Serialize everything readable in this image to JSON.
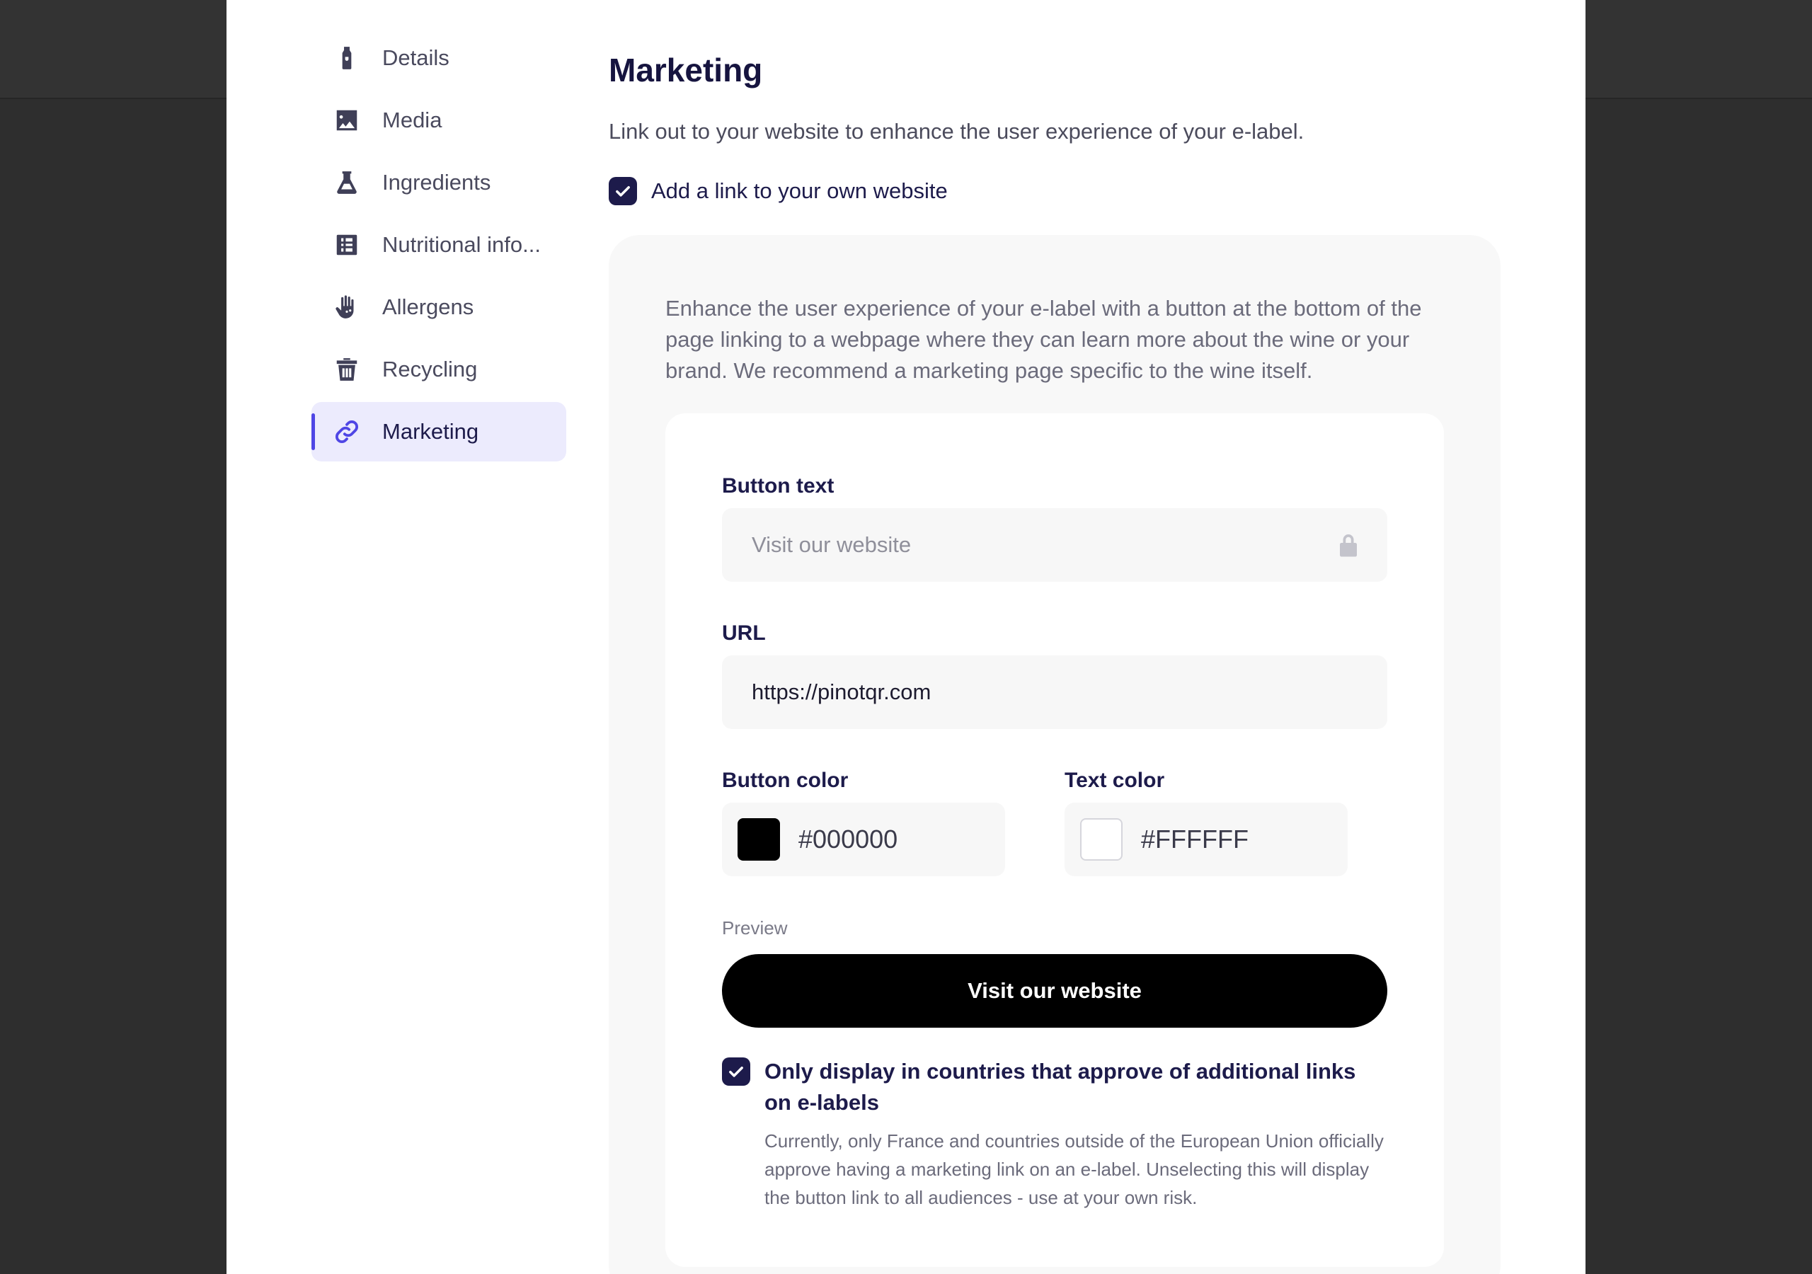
{
  "sidebar": {
    "items": [
      {
        "label": "Details",
        "icon": "bottle-icon"
      },
      {
        "label": "Media",
        "icon": "image-icon"
      },
      {
        "label": "Ingredients",
        "icon": "flask-icon"
      },
      {
        "label": "Nutritional info...",
        "icon": "list-icon"
      },
      {
        "label": "Allergens",
        "icon": "hand-icon"
      },
      {
        "label": "Recycling",
        "icon": "trash-icon"
      },
      {
        "label": "Marketing",
        "icon": "link-icon",
        "active": true
      }
    ]
  },
  "main": {
    "title": "Marketing",
    "intro": "Link out to your website to enhance the user experience of your e-label.",
    "add_link_label": "Add a link to your own website",
    "add_link_checked": true,
    "card_description": "Enhance the user experience of your e-label with a button at the bottom of the page linking to a webpage where they can learn more about the wine or your brand. We recommend a marketing page specific to the wine itself.",
    "button_text": {
      "label": "Button text",
      "value": "Visit our website",
      "locked": true
    },
    "url": {
      "label": "URL",
      "value": "https://pinotqr.com"
    },
    "button_color": {
      "label": "Button color",
      "value": "#000000"
    },
    "text_color": {
      "label": "Text color",
      "value": "#FFFFFF"
    },
    "preview_label": "Preview",
    "preview_button_label": "Visit our website",
    "country_restriction": {
      "checked": true,
      "label": "Only display in countries that approve of additional links on e-labels",
      "note": "Currently, only France and countries outside of the European Union officially approve having a marketing link on an e-label. Unselecting this will display the button link to all audiences - use at your own risk."
    }
  },
  "colors": {
    "accent": "#4f46e5",
    "navy": "#1d1b4b",
    "active_bg": "#ecebfd",
    "backdrop": "#2e2e2e"
  }
}
